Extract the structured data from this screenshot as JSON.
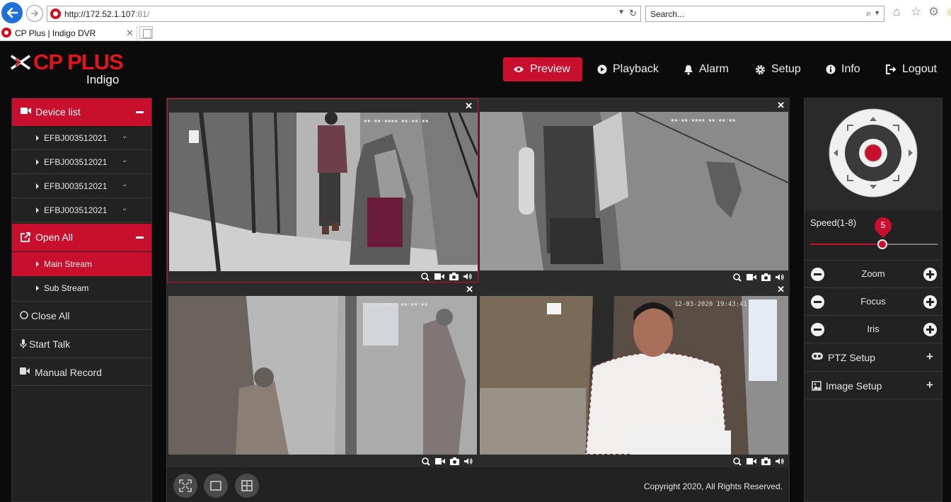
{
  "browser": {
    "url_host": "http://172.52.1.107",
    "url_port": ":81/",
    "search_placeholder": "Search...",
    "tab_title": "CP Plus | Indigo DVR"
  },
  "brand": {
    "name": "CP PLUS",
    "product": "Indigo",
    "color": "#e0161f"
  },
  "nav": {
    "preview": "Preview",
    "playback": "Playback",
    "alarm": "Alarm",
    "setup": "Setup",
    "info": "Info",
    "logout": "Logout"
  },
  "sidebar": {
    "device_list": "Device list",
    "devices": [
      "EFBJ003512021",
      "EFBJ003512021",
      "EFBJ003512021",
      "EFBJ003512021"
    ],
    "open_all": "Open All",
    "main_stream": "Main Stream",
    "sub_stream": "Sub Stream",
    "close_all": "Close All",
    "start_talk": "Start Talk",
    "manual_record": "Manual Record"
  },
  "cameras": {
    "cam2_timestamp": "12-03-2020 19:43:41"
  },
  "footer": {
    "copyright": "Copyright 2020, All Rights Reserved."
  },
  "ptz": {
    "speed_label": "Speed(1-8)",
    "speed_value": "5",
    "zoom": "Zoom",
    "focus": "Focus",
    "iris": "Iris",
    "ptz_setup": "PTZ Setup",
    "image_setup": "Image Setup"
  },
  "colors": {
    "accent": "#c8102e",
    "panel": "#222222",
    "background": "#0b0b0b"
  }
}
